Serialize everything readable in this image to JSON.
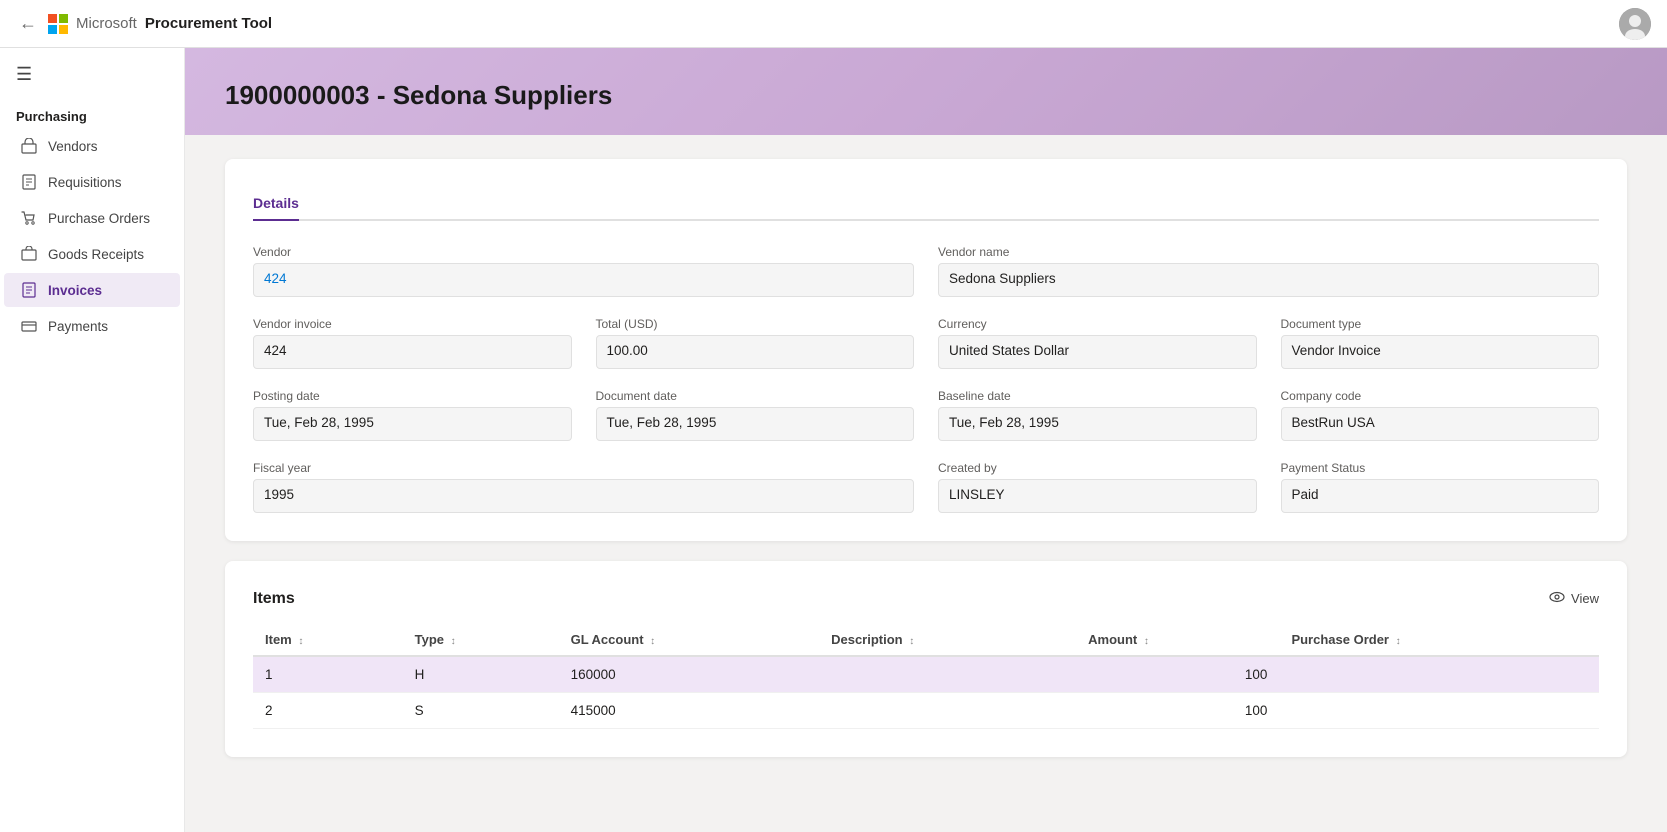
{
  "app": {
    "title": "Procurement Tool",
    "back_icon": "←"
  },
  "topbar": {
    "app_name": "Microsoft",
    "tool_name": "Procurement Tool"
  },
  "sidebar": {
    "section": "Purchasing",
    "hamburger": "☰",
    "items": [
      {
        "id": "vendors",
        "label": "Vendors",
        "icon": "🏪",
        "active": false
      },
      {
        "id": "requisitions",
        "label": "Requisitions",
        "icon": "📋",
        "active": false
      },
      {
        "id": "purchase-orders",
        "label": "Purchase Orders",
        "icon": "🛒",
        "active": false
      },
      {
        "id": "goods-receipts",
        "label": "Goods Receipts",
        "icon": "📦",
        "active": false
      },
      {
        "id": "invoices",
        "label": "Invoices",
        "icon": "📄",
        "active": true
      },
      {
        "id": "payments",
        "label": "Payments",
        "icon": "💳",
        "active": false
      }
    ]
  },
  "page": {
    "title": "1900000003 - Sedona Suppliers"
  },
  "tabs": [
    {
      "id": "details",
      "label": "Details",
      "active": true
    }
  ],
  "details": {
    "vendor_label": "Vendor",
    "vendor_value": "424",
    "vendor_name_label": "Vendor name",
    "vendor_name_value": "Sedona Suppliers",
    "vendor_invoice_label": "Vendor invoice",
    "vendor_invoice_value": "424",
    "total_usd_label": "Total (USD)",
    "total_usd_value": "100.00",
    "currency_label": "Currency",
    "currency_value": "United States Dollar",
    "document_type_label": "Document type",
    "document_type_value": "Vendor Invoice",
    "posting_date_label": "Posting date",
    "posting_date_value": "Tue, Feb 28, 1995",
    "document_date_label": "Document date",
    "document_date_value": "Tue, Feb 28, 1995",
    "baseline_date_label": "Baseline date",
    "baseline_date_value": "Tue, Feb 28, 1995",
    "company_code_label": "Company code",
    "company_code_value": "BestRun USA",
    "fiscal_year_label": "Fiscal year",
    "fiscal_year_value": "1995",
    "created_by_label": "Created by",
    "created_by_value": "LINSLEY",
    "payment_status_label": "Payment Status",
    "payment_status_value": "Paid"
  },
  "items": {
    "section_title": "Items",
    "view_label": "View",
    "view_icon": "👁",
    "columns": [
      {
        "id": "item",
        "label": "Item",
        "sortable": true
      },
      {
        "id": "type",
        "label": "Type",
        "sortable": true
      },
      {
        "id": "gl_account",
        "label": "GL Account",
        "sortable": true
      },
      {
        "id": "description",
        "label": "Description",
        "sortable": true
      },
      {
        "id": "amount",
        "label": "Amount",
        "sortable": true
      },
      {
        "id": "purchase_order",
        "label": "Purchase Order",
        "sortable": true
      }
    ],
    "rows": [
      {
        "item": "1",
        "type": "H",
        "gl_account": "160000",
        "description": "",
        "amount": "100",
        "purchase_order": "",
        "highlighted": true,
        "amount_link": false
      },
      {
        "item": "2",
        "type": "S",
        "gl_account": "415000",
        "description": "",
        "amount": "100",
        "purchase_order": "",
        "highlighted": false,
        "amount_link": true
      }
    ]
  }
}
